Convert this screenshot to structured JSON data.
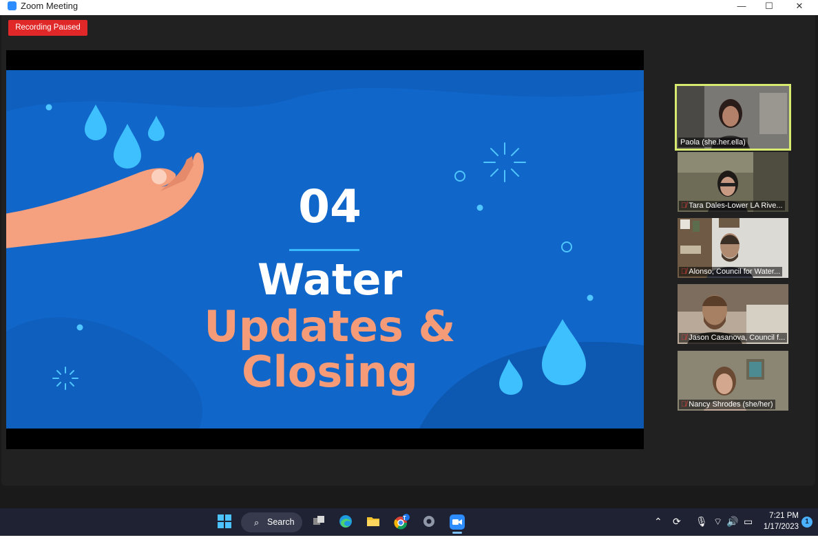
{
  "window": {
    "title": "Zoom Meeting",
    "controls": {
      "minimize": "—",
      "maximize": "☐",
      "close": "✕"
    }
  },
  "recording": {
    "status": "Recording Paused"
  },
  "slide": {
    "number": "04",
    "title_line1": "Water",
    "title_line2": "Updates &",
    "title_line3": "Closing",
    "colors": {
      "background": "#1166c9",
      "accent": "#f59b78",
      "drop": "#37b8ff"
    }
  },
  "participants": [
    {
      "name": "Paola (she.her.ella)",
      "muted": false,
      "active_speaker": true
    },
    {
      "name": "Tara Dales-Lower LA Rive...",
      "muted": true,
      "active_speaker": false
    },
    {
      "name": "Alonso, Council for Water...",
      "muted": true,
      "active_speaker": false
    },
    {
      "name": "Jason Casanova, Council f...",
      "muted": true,
      "active_speaker": false
    },
    {
      "name": "Nancy Shrodes (she/her)",
      "muted": true,
      "active_speaker": false
    }
  ],
  "taskbar": {
    "search_label": "Search",
    "apps": [
      "windows-start",
      "search",
      "task-view",
      "edge",
      "file-explorer",
      "chrome",
      "settings",
      "zoom"
    ],
    "chrome_badge": "T",
    "clock": {
      "time": "7:21 PM",
      "date": "1/17/2023"
    },
    "notification_count": "1"
  },
  "icons": {
    "mic_muted": "mic-muted-icon",
    "tray": [
      "chevron-up-icon",
      "sync-icon",
      "microphone-icon",
      "wifi-icon",
      "volume-icon",
      "battery-icon"
    ]
  }
}
